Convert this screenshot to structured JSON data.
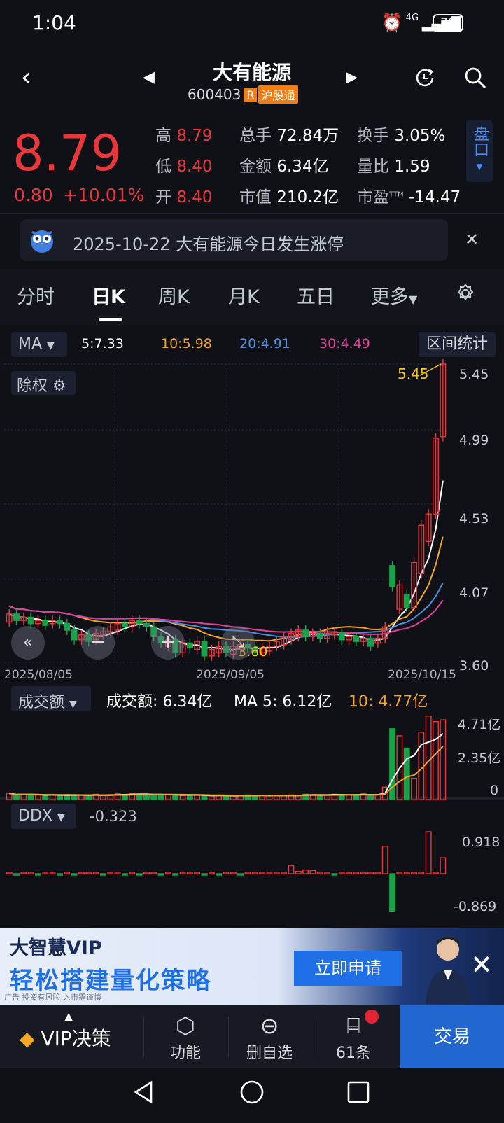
{
  "status": {
    "time": "1:04",
    "network": "4G",
    "battery": "79"
  },
  "header": {
    "title": "大有能源",
    "code": "600403",
    "tag_r": "R",
    "tag_connect": "沪股通"
  },
  "quote": {
    "price": "8.79",
    "change": "0.80",
    "change_pct": "+10.01%",
    "high_label": "高",
    "high": "8.79",
    "low_label": "低",
    "low": "8.40",
    "open_label": "开",
    "open": "8.40",
    "volume_label": "总手",
    "volume": "72.84万",
    "amount_label": "金额",
    "amount": "6.34亿",
    "mktcap_label": "市值",
    "mktcap": "210.2亿",
    "turnover_label": "换手",
    "turnover": "3.05%",
    "vol_ratio_label": "量比",
    "vol_ratio": "1.59",
    "pe_label": "市盈",
    "pe_sup": "TTM",
    "pe": "-14.47",
    "pankou": "盘口"
  },
  "news": {
    "text": "2025-10-22 大有能源今日发生涨停"
  },
  "tabs": [
    "分时",
    "日K",
    "周K",
    "月K",
    "五日",
    "更多"
  ],
  "ma_row": {
    "selector": "MA",
    "ma5": "5:7.33",
    "ma10": "10:5.98",
    "ma20": "20:4.91",
    "ma30": "30:4.49",
    "range_stats": "区间统计"
  },
  "kline": {
    "adjust_label": "除权",
    "y_labels": [
      "5.45",
      "4.99",
      "4.53",
      "4.07",
      "3.60"
    ],
    "x_labels": [
      "2025/08/05",
      "2025/09/05",
      "2025/10/15"
    ],
    "max_marker": "5.45",
    "min_marker": "3.60"
  },
  "volume_panel": {
    "selector": "成交额",
    "amount_text": "成交额: 6.34亿",
    "ma5_text": "MA 5: 6.12亿",
    "ma10_text": "10: 4.77亿",
    "y_labels": [
      "4.71亿",
      "2.35亿",
      "0"
    ]
  },
  "ddx_panel": {
    "selector": "DDX",
    "value": "-0.323",
    "y_labels": [
      "0.918",
      "-0.869"
    ]
  },
  "ad": {
    "brand": "大智慧VIP",
    "slogan": "轻松搭建量化策略",
    "button": "立即申请",
    "disclaimer": "广告 投资有风险 入市需谨慎"
  },
  "toolbar": {
    "vip": "VIP决策",
    "function": "功能",
    "remove_watch": "删自选",
    "messages": "61条",
    "trade": "交易"
  },
  "colors": {
    "up": "#e8383d",
    "down": "#18a34a",
    "ma5": "#ffffff",
    "ma10": "#f5a623",
    "ma20": "#4a90e2",
    "ma30": "#e0409a",
    "accent": "#2266d0"
  },
  "chart_data": {
    "type": "candlestick",
    "ylim": [
      3.6,
      5.45
    ],
    "x_range": [
      "2025/08/05",
      "2025/10/15"
    ],
    "candles": [
      {
        "o": 3.85,
        "c": 3.9
      },
      {
        "o": 3.9,
        "c": 3.86
      },
      {
        "o": 3.86,
        "c": 3.88
      },
      {
        "o": 3.88,
        "c": 3.84
      },
      {
        "o": 3.84,
        "c": 3.86
      },
      {
        "o": 3.86,
        "c": 3.83
      },
      {
        "o": 3.84,
        "c": 3.86
      },
      {
        "o": 3.86,
        "c": 3.84
      },
      {
        "o": 3.84,
        "c": 3.8
      },
      {
        "o": 3.8,
        "c": 3.74
      },
      {
        "o": 3.74,
        "c": 3.77
      },
      {
        "o": 3.77,
        "c": 3.73
      },
      {
        "o": 3.74,
        "c": 3.78
      },
      {
        "o": 3.77,
        "c": 3.79
      },
      {
        "o": 3.79,
        "c": 3.82
      },
      {
        "o": 3.8,
        "c": 3.84
      },
      {
        "o": 3.84,
        "c": 3.82
      },
      {
        "o": 3.82,
        "c": 3.86
      },
      {
        "o": 3.86,
        "c": 3.84
      },
      {
        "o": 3.84,
        "c": 3.82
      },
      {
        "o": 3.82,
        "c": 3.76
      },
      {
        "o": 3.76,
        "c": 3.72
      },
      {
        "o": 3.7,
        "c": 3.74
      },
      {
        "o": 3.74,
        "c": 3.66
      },
      {
        "o": 3.66,
        "c": 3.72
      },
      {
        "o": 3.72,
        "c": 3.69
      },
      {
        "o": 3.68,
        "c": 3.73
      },
      {
        "o": 3.73,
        "c": 3.64
      },
      {
        "o": 3.64,
        "c": 3.68
      },
      {
        "o": 3.66,
        "c": 3.7
      },
      {
        "o": 3.7,
        "c": 3.66
      },
      {
        "o": 3.65,
        "c": 3.7
      },
      {
        "o": 3.68,
        "c": 3.71
      },
      {
        "o": 3.71,
        "c": 3.69
      },
      {
        "o": 3.69,
        "c": 3.66
      },
      {
        "o": 3.66,
        "c": 3.69
      },
      {
        "o": 3.67,
        "c": 3.7
      },
      {
        "o": 3.7,
        "c": 3.73
      },
      {
        "o": 3.71,
        "c": 3.76
      },
      {
        "o": 3.74,
        "c": 3.78
      },
      {
        "o": 3.76,
        "c": 3.8
      },
      {
        "o": 3.8,
        "c": 3.76
      },
      {
        "o": 3.76,
        "c": 3.78
      },
      {
        "o": 3.78,
        "c": 3.75
      },
      {
        "o": 3.75,
        "c": 3.79
      },
      {
        "o": 3.77,
        "c": 3.79
      },
      {
        "o": 3.78,
        "c": 3.74
      },
      {
        "o": 3.74,
        "c": 3.76
      },
      {
        "o": 3.76,
        "c": 3.73
      },
      {
        "o": 3.73,
        "c": 3.75
      },
      {
        "o": 3.75,
        "c": 3.7
      },
      {
        "o": 3.72,
        "c": 3.75
      },
      {
        "o": 3.75,
        "c": 3.82
      },
      {
        "o": 4.2,
        "c": 4.07
      },
      {
        "o": 3.93,
        "c": 4.08
      },
      {
        "o": 4.02,
        "c": 3.94
      },
      {
        "o": 3.94,
        "c": 4.22
      },
      {
        "o": 4.15,
        "c": 4.45
      },
      {
        "o": 4.35,
        "c": 4.52
      },
      {
        "o": 4.52,
        "c": 4.99
      },
      {
        "o": 5.0,
        "c": 5.45
      }
    ],
    "ma_series": [
      {
        "name": "MA5",
        "end": 4.6
      },
      {
        "name": "MA10",
        "end": 4.24
      },
      {
        "name": "MA20",
        "end": 3.99
      },
      {
        "name": "MA30",
        "end": 3.9
      }
    ],
    "volume_yi": [
      0.35,
      0.22,
      0.28,
      0.3,
      0.25,
      0.24,
      0.26,
      0.22,
      0.28,
      0.26,
      0.24,
      0.2,
      0.3,
      0.22,
      0.28,
      0.32,
      0.26,
      0.34,
      0.3,
      0.28,
      0.26,
      0.24,
      0.3,
      0.28,
      0.22,
      0.26,
      0.24,
      0.22,
      0.2,
      0.24,
      0.22,
      0.2,
      0.24,
      0.26,
      0.22,
      0.24,
      0.2,
      0.22,
      0.24,
      0.26,
      0.22,
      0.3,
      0.28,
      0.24,
      0.26,
      0.3,
      0.28,
      0.26,
      0.24,
      0.32,
      0.26,
      0.28,
      0.7,
      4.0,
      3.6,
      2.9,
      1.2,
      3.8,
      4.71,
      4.4,
      4.5
    ],
    "ddx": [
      0.02,
      -0.01,
      0.01,
      0.02,
      -0.02,
      0.0,
      0.01,
      -0.03,
      0.02,
      -0.02,
      0.01,
      0.0,
      0.01,
      -0.02,
      0.02,
      0.01,
      -0.01,
      0.02,
      -0.01,
      0.02,
      0.01,
      -0.02,
      0.01,
      -0.01,
      0.02,
      0.01,
      0.0,
      -0.02,
      0.01,
      -0.01,
      0.02,
      0.01,
      -0.01,
      0.02,
      0.01,
      0.02,
      0.0,
      0.01,
      0.02,
      0.18,
      0.05,
      0.08,
      0.07,
      0.01,
      0.02,
      -0.01,
      0.02,
      0.01,
      0.02,
      0.03,
      0.01,
      0.02,
      0.6,
      -0.869,
      0.01,
      0.02,
      0.03,
      0.02,
      0.918,
      0.01,
      0.35,
      -0.323
    ]
  }
}
